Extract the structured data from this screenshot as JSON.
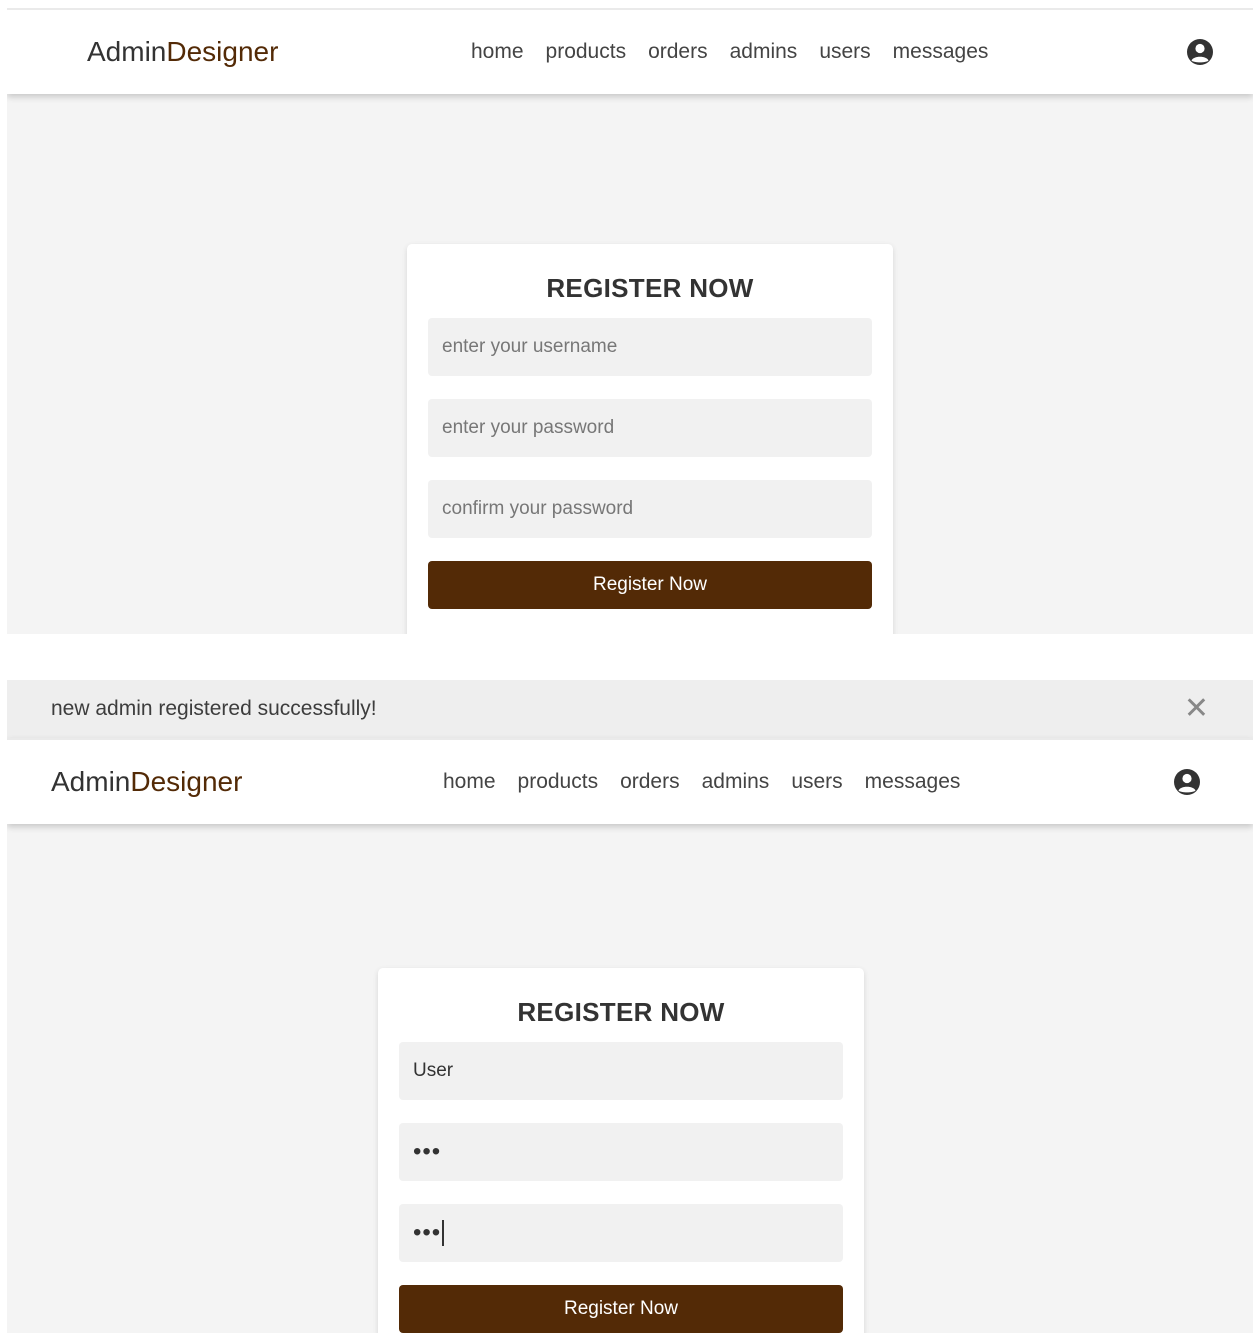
{
  "screen1": {
    "logo": {
      "part1": "Admin",
      "part2": "Designer"
    },
    "nav": [
      "home",
      "products",
      "orders",
      "admins",
      "users",
      "messages"
    ],
    "form": {
      "title": "REGISTER NOW",
      "username_placeholder": "enter your username",
      "password_placeholder": "enter your password",
      "confirm_placeholder": "confirm your password",
      "submit_label": "Register Now"
    }
  },
  "screen2": {
    "flash": {
      "message": "new admin registered successfully!",
      "close_glyph": "✕"
    },
    "logo": {
      "part1": "Admin",
      "part2": "Designer"
    },
    "nav": [
      "home",
      "products",
      "orders",
      "admins",
      "users",
      "messages"
    ],
    "form": {
      "title": "REGISTER NOW",
      "username_value": "User",
      "password_value": "•••",
      "confirm_value": "•••",
      "submit_label": "Register Now"
    }
  },
  "colors": {
    "accent": "#532a06",
    "background": "#f4f4f4",
    "field": "#f1f1f1"
  },
  "icons": {
    "account": "user-circle-icon",
    "close": "close-icon"
  }
}
